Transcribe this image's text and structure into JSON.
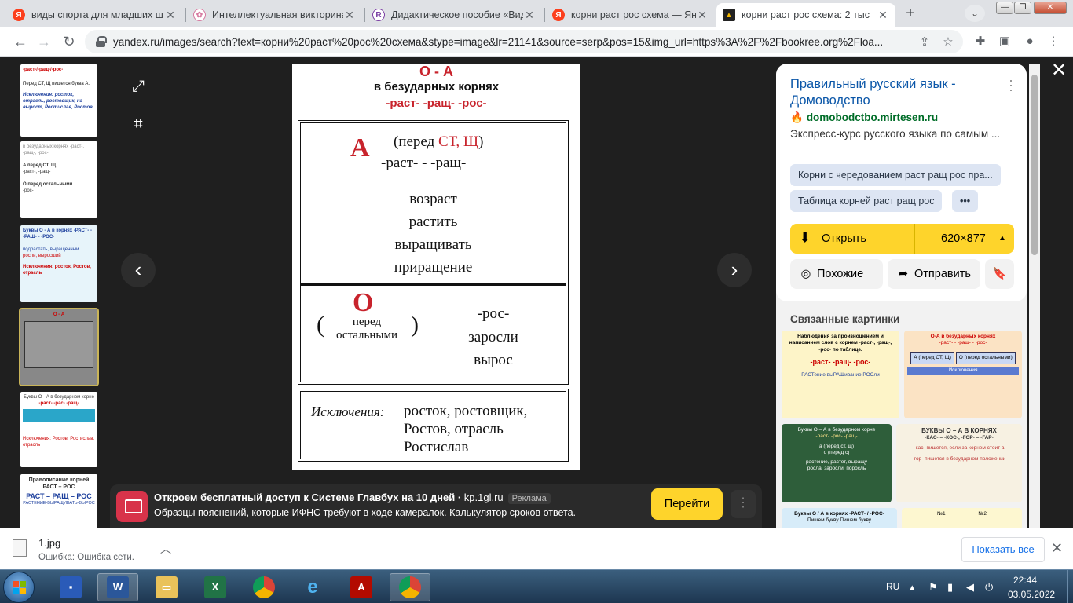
{
  "browser": {
    "tabs": [
      {
        "title": "виды спорта для младших ш",
        "favicon": "yandex-icon",
        "color": "#fc3f1d",
        "glyph": "Я"
      },
      {
        "title": "Интеллектуальная викторина",
        "favicon": "knot-icon",
        "color": "#d67aa0",
        "glyph": "✿"
      },
      {
        "title": "Дидактическое пособие «Вид",
        "favicon": "site-icon",
        "color": "#7b3fa3",
        "glyph": "R"
      },
      {
        "title": "корни раст рос схема — Янд",
        "favicon": "yandex-icon",
        "color": "#fc3f1d",
        "glyph": "Я"
      },
      {
        "title": "корни раст рос схема: 2 тыс",
        "favicon": "image-icon",
        "color": "#f5b800",
        "glyph": "▲"
      }
    ],
    "url": "yandex.ru/images/search?text=корни%20раст%20рос%20схема&stype=image&lr=21141&source=serp&pos=15&img_url=https%3A%2F%2Fbookree.org%2Floa..."
  },
  "main_image": {
    "header_oa": "О - А",
    "header_sub": "в безударных корнях",
    "header_roots": "-раст- -ращ- -рос-",
    "a_letter": "А",
    "a_cond_prefix": "(перед ",
    "a_cond_red": "СТ, Щ",
    "a_cond_suffix": ")",
    "a_roots": "-раст- - -ращ-",
    "a_words": [
      "возраст",
      "растить",
      "выращивать",
      "приращение"
    ],
    "o_letter": "О",
    "o_cond_line1": "перед",
    "o_cond_line2": "остальными",
    "o_root": "-рос-",
    "o_words": [
      "заросли",
      "вырос"
    ],
    "exceptions_label": "Исключения:",
    "exceptions_lines": [
      "росток, ростовщик,",
      "Ростов, отрасль",
      "Ростислав"
    ]
  },
  "thumbnails": {
    "t1": [
      "-раст-/-ращ-/-рос-",
      "Перед СТ, Щ пишется буква А.",
      "Исключения: росток, отрасль, ростовщик, на вырост, Ростислав, Ростов"
    ],
    "t2": [
      "в безударных корнях -раст-, -ращ-, -рос-",
      "А перед СТ, Щ",
      "-раст-, -ращ-",
      "О перед остальными",
      "-рос-"
    ],
    "t3": [
      "Буквы О - А в корнях -РАСТ- - -РАЩ- - -РОС-",
      "подрастать, выращенный",
      "росли, выросший",
      "Исключения: росток, Ростов, отрасль"
    ],
    "t4": [
      "О - А"
    ],
    "t5": [
      "Буквы О - А в безударном корне",
      "-раст- -рас- -ращ-",
      "Исключения: Ростов, Ростислав, отрасль"
    ],
    "t6": [
      "Правописание корней",
      "РАСТ – РОС",
      "РАСТ – РАЩ – РОС",
      "РАСТЕНИЕ-ВЫРАЩИВАТЬ-ВЫРОС"
    ]
  },
  "ad": {
    "title": "Откроем бесплатный доступ к Системе Главбух на 10 дней",
    "domain": "kp.1gl.ru",
    "tag": "Реклама",
    "description": "Образцы пояснений, которые ИФНС требуют в ходе камералок. Калькулятор сроков ответа.",
    "button": "Перейти"
  },
  "side_panel": {
    "title": "Правильный русский язык - Домоводство",
    "site": "domobodctbo.mirtesen.ru",
    "description": "Экспресс-курс русского языка по самым ...",
    "chips": [
      "Корни с чередованием раст ращ рос пра...",
      "Таблица корней раст ращ рос",
      "•••"
    ],
    "open_label": "Открыть",
    "size": "620×877",
    "similar_label": "Похожие",
    "share_label": "Отправить",
    "related_title": "Связанные картинки",
    "related": [
      {
        "lines": [
          "Наблюдения за произношением и написанием слов с корнем -раст-, -ращ-, -рос- по таблице.",
          "-раст-  -ращ-  -рос-",
          "РАСТение  выРАЩивание  РОСли"
        ]
      },
      {
        "lines": [
          "О-А в безударных корнях",
          "-раст- - -ращ- - -рос-",
          "А (перед СТ, Щ)",
          "О (перед остальными)",
          "Исключения"
        ]
      },
      {
        "lines": [
          "Буквы О – А в безударном корне",
          "-раст- -рос- -ращ-",
          "а (перед ст, щ)",
          "о (перед с)",
          "растение, растет, выращу",
          "росла, заросли, поросль"
        ]
      },
      {
        "lines": [
          "БУКВЫ О – А В КОРНЯХ",
          "-КАС- – -КОС-, -ГОР- – -ГАР-",
          "-кас- пишется, если за корнем стоит а",
          "-гор- пишется в безударном положении"
        ]
      },
      {
        "lines": [
          "Буквы О / А в корнях -РАСТ- / -РОС-",
          "Пишем букву   Пишем букву"
        ]
      },
      {
        "lines": [
          "№1",
          "№2"
        ]
      }
    ]
  },
  "download_bar": {
    "filename": "1.jpg",
    "status": "Ошибка: Ошибка сети.",
    "show_all": "Показать все"
  },
  "taskbar": {
    "lang": "RU",
    "time": "22:44",
    "date": "03.05.2022"
  }
}
